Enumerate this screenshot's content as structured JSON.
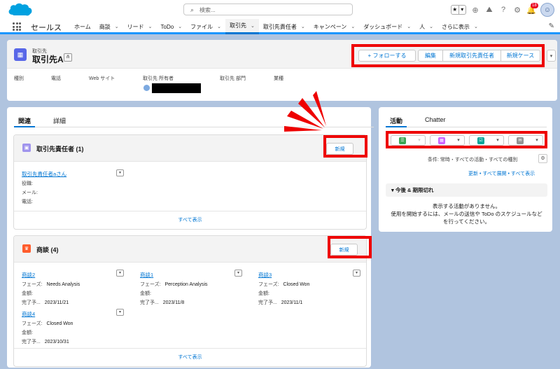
{
  "search": {
    "placeholder": "検索..."
  },
  "header": {
    "notifications_count": "18"
  },
  "app": {
    "name": "セールス",
    "nav": [
      {
        "label": "ホーム",
        "chevron": false
      },
      {
        "label": "商談",
        "chevron": true
      },
      {
        "label": "リード",
        "chevron": true
      },
      {
        "label": "ToDo",
        "chevron": true
      },
      {
        "label": "ファイル",
        "chevron": true
      },
      {
        "label": "取引先",
        "chevron": true,
        "active": true
      },
      {
        "label": "取引先責任者",
        "chevron": true
      },
      {
        "label": "キャンペーン",
        "chevron": true
      },
      {
        "label": "ダッシュボード",
        "chevron": true
      },
      {
        "label": "人",
        "chevron": true
      },
      {
        "label": "さらに表示",
        "chevron": true
      }
    ]
  },
  "record": {
    "object_type": "取引先",
    "name": "取引先A",
    "buttons": {
      "follow": "+ フォローする",
      "edit": "編集",
      "new_contact": "新規取引先責任者",
      "new_case": "新規ケース"
    },
    "fields": [
      "種別",
      "電話",
      "Web サイト",
      "取引先 所有者",
      "取引先 部門",
      "業種"
    ]
  },
  "left_tabs": [
    "関連",
    "詳細"
  ],
  "contacts": {
    "title": "取引先責任者 (1)",
    "new_label": "新規",
    "items": [
      {
        "name": "取引先責任者aさん",
        "labels": [
          "役職:",
          "メール:",
          "電話:"
        ]
      }
    ],
    "view_all": "すべて表示"
  },
  "opportunities": {
    "title": "商談 (4)",
    "new_label": "新規",
    "label_phase": "フェーズ:",
    "label_amount": "金額:",
    "label_close": "完了予...",
    "items": [
      {
        "name": "商談2",
        "phase": "Needs Analysis",
        "close": "2023/11/21"
      },
      {
        "name": "商談1",
        "phase": "Perception Analysis",
        "close": "2023/11/8"
      },
      {
        "name": "商談3",
        "phase": "Closed Won",
        "close": "2023/11/1"
      },
      {
        "name": "商談4",
        "phase": "Closed Won",
        "close": "2023/10/31"
      }
    ],
    "view_all": "すべて表示"
  },
  "right_tabs": [
    "活動",
    "Chatter"
  ],
  "activity": {
    "filter": "条件: 常時・すべての活動・すべての種別",
    "links": "更新 • すべて展開 • すべて表示",
    "upcoming": "今後 & 期限切れ",
    "empty_line1": "表示する活動がありません。",
    "empty_line2": "使用を開始するには、メールの送信や ToDo のスケジュールなど",
    "empty_line3": "を行ってください。",
    "icon_colors": [
      "#3ba755",
      "#cb65ff",
      "#06a59a",
      "#939393"
    ]
  },
  "colors": {
    "brand": "#0176d3",
    "highlight": "#ee0000"
  }
}
